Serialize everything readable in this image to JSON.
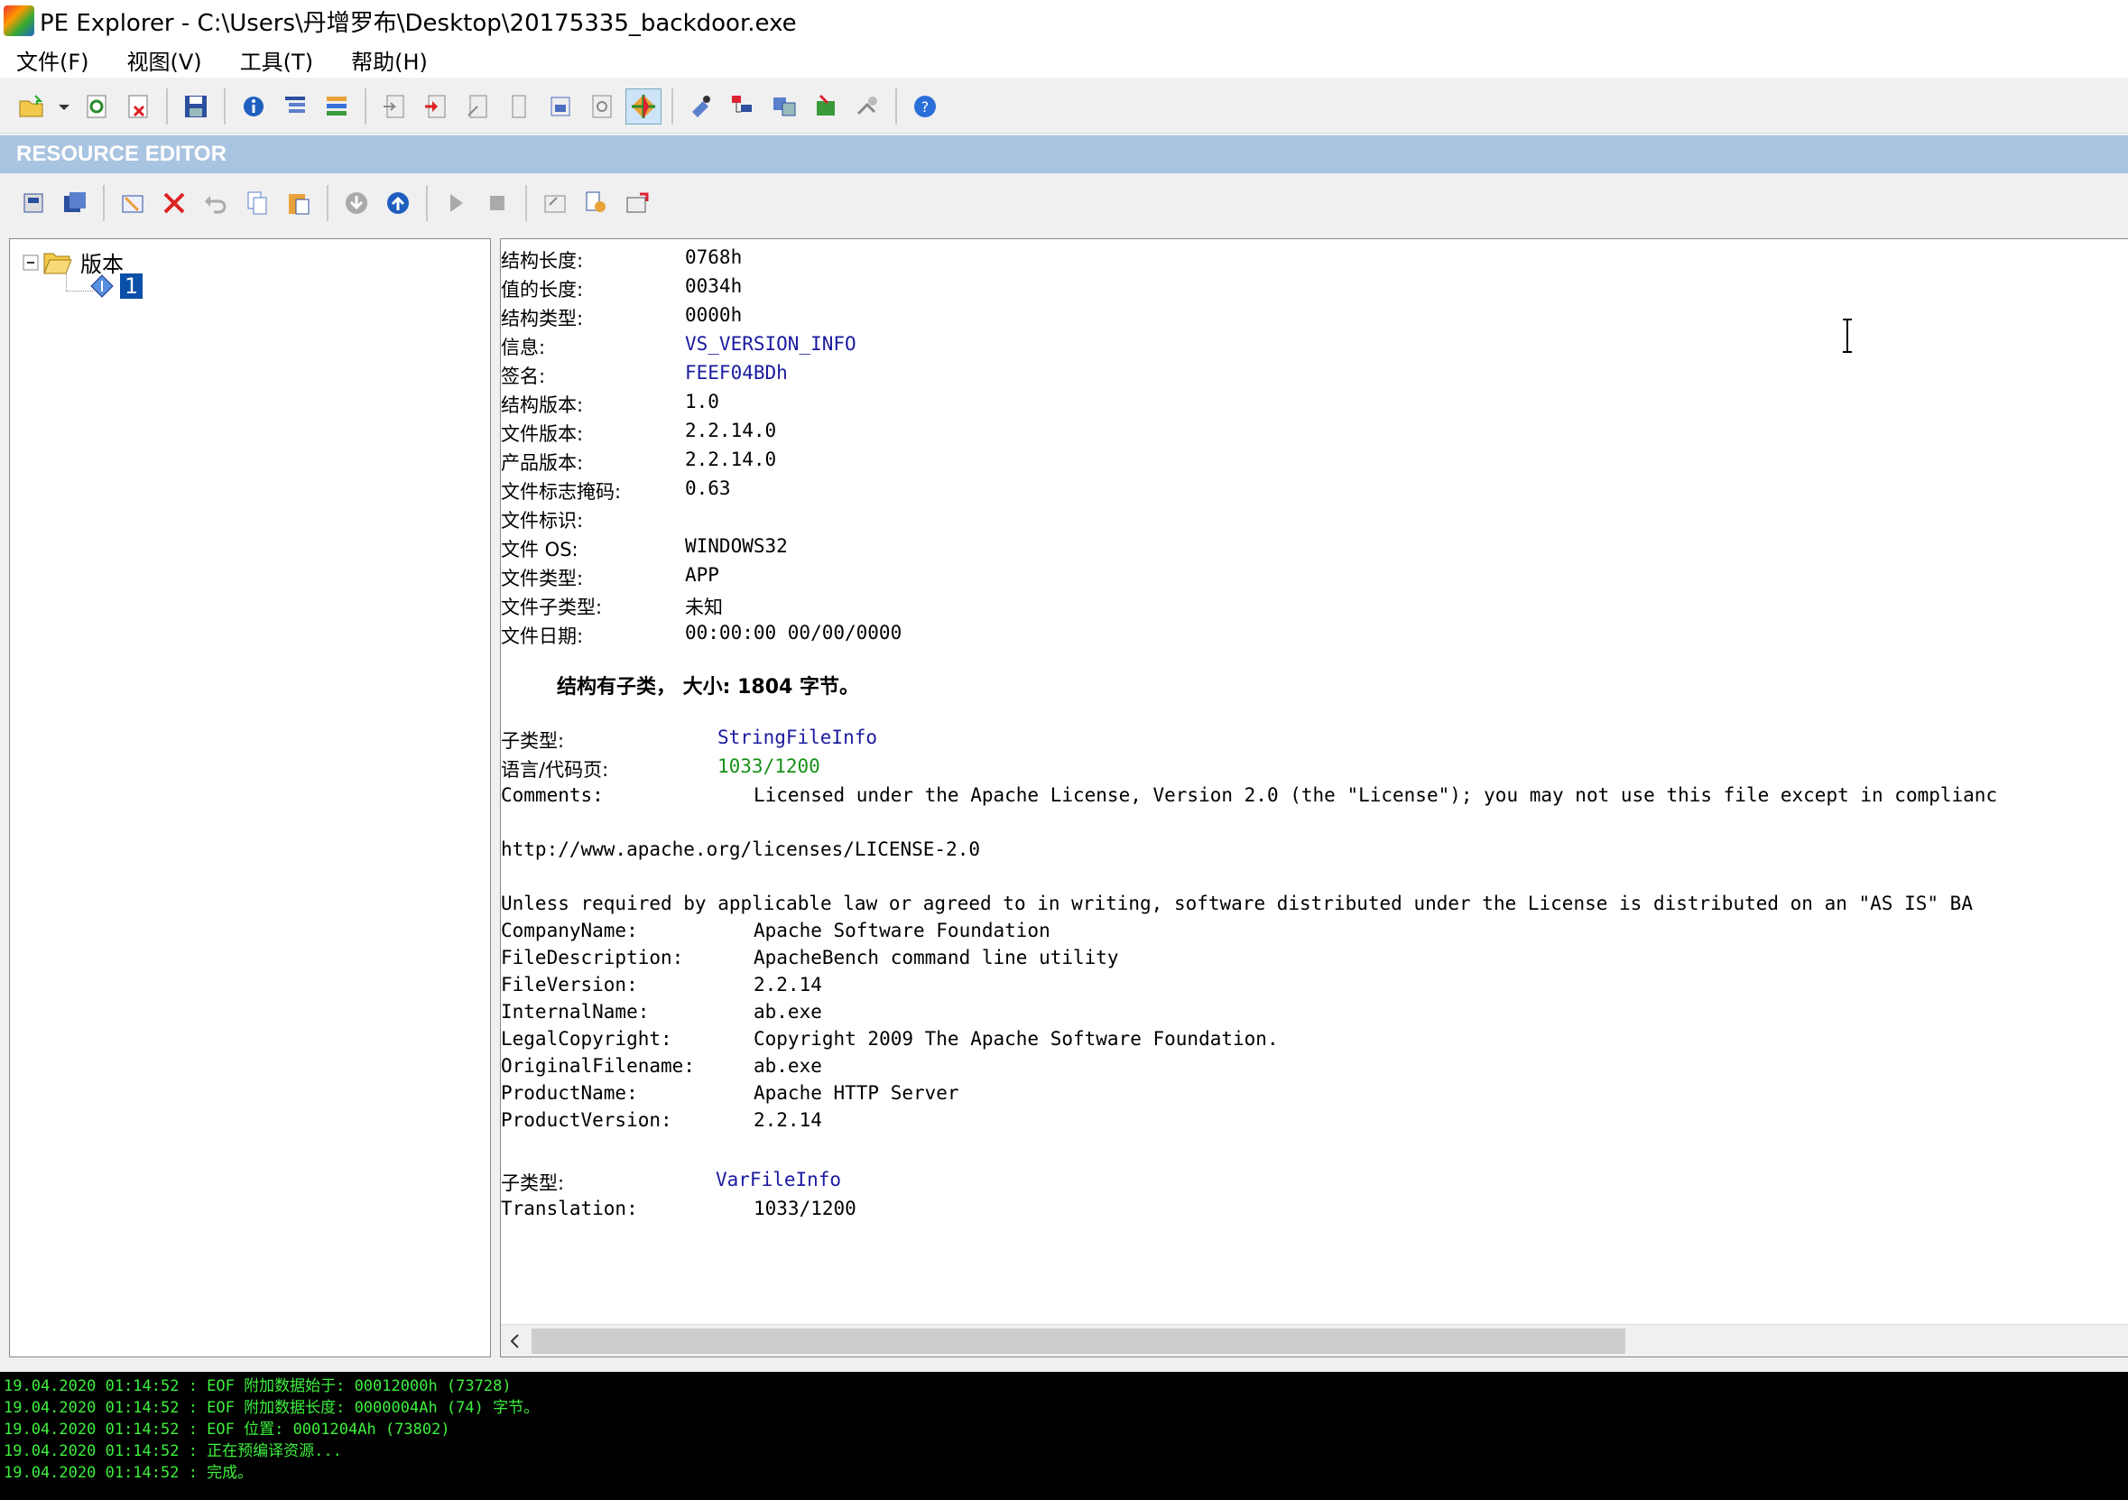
{
  "window": {
    "title": "PE Explorer - C:\\Users\\丹增罗布\\Desktop\\20175335_backdoor.exe"
  },
  "menu": [
    "文件(F)",
    "视图(V)",
    "工具(T)",
    "帮助(H)"
  ],
  "editor": {
    "header": "RESOURCE EDITOR"
  },
  "tree": {
    "root": "版本",
    "child": "1"
  },
  "fields": [
    {
      "label": "结构长度:",
      "value": "0768h",
      "color": "black"
    },
    {
      "label": "值的长度:",
      "value": "0034h",
      "color": "black"
    },
    {
      "label": "结构类型:",
      "value": "0000h",
      "color": "black"
    },
    {
      "label": "信息:",
      "value": "VS_VERSION_INFO",
      "color": "blue"
    },
    {
      "label": "签名:",
      "value": "FEEF04BDh",
      "color": "blue"
    },
    {
      "label": "结构版本:",
      "value": "1.0",
      "color": "black"
    },
    {
      "label": "文件版本:",
      "value": "2.2.14.0",
      "color": "black"
    },
    {
      "label": "产品版本:",
      "value": "2.2.14.0",
      "color": "black"
    },
    {
      "label": "文件标志掩码:",
      "value": "0.63",
      "color": "black"
    },
    {
      "label": "文件标识:",
      "value": "",
      "color": "black"
    },
    {
      "label": "文件 OS:",
      "value": "WINDOWS32",
      "color": "black"
    },
    {
      "label": "文件类型:",
      "value": "APP",
      "color": "black"
    },
    {
      "label": "文件子类型:",
      "value": "未知",
      "color": "black"
    },
    {
      "label": "文件日期:",
      "value": "00:00:00  00/00/0000",
      "color": "black"
    }
  ],
  "summary": "结构有子类， 大小: 1804 字节。",
  "string_file": {
    "subtype_label": "子类型:",
    "subtype_value": "StringFileInfo",
    "lang_label": "语言/代码页:",
    "lang_value": "1033/1200",
    "comments_label": "Comments:",
    "comments_value": "Licensed under the Apache License, Version 2.0 (the \"License\"); you may not use this file except in complianc",
    "url": "http://www.apache.org/licenses/LICENSE-2.0",
    "unless": "Unless required by applicable law or agreed to in writing, software distributed under the License is distributed on an \"AS IS\" BA",
    "entries": [
      {
        "key": "CompanyName:",
        "value": "Apache Software Foundation"
      },
      {
        "key": "FileDescription:",
        "value": "ApacheBench command line utility"
      },
      {
        "key": "FileVersion:",
        "value": "2.2.14"
      },
      {
        "key": "InternalName:",
        "value": "ab.exe"
      },
      {
        "key": "LegalCopyright:",
        "value": "Copyright 2009 The Apache Software Foundation."
      },
      {
        "key": "OriginalFilename:",
        "value": "ab.exe"
      },
      {
        "key": "ProductName:",
        "value": "Apache HTTP Server"
      },
      {
        "key": "ProductVersion:",
        "value": "2.2.14"
      }
    ]
  },
  "var_file": {
    "subtype_label": "子类型:",
    "subtype_value": "VarFileInfo",
    "translation_label": "Translation:",
    "translation_value": "1033/1200"
  },
  "log": [
    "19.04.2020 01:14:52 : EOF 附加数据始于: 00012000h  (73728)",
    "19.04.2020 01:14:52 : EOF 附加数据长度: 0000004Ah  (74) 字节。",
    "19.04.2020 01:14:52 : EOF 位置: 0001204Ah  (73802)",
    "19.04.2020 01:14:52 : 正在预编译资源...",
    "19.04.2020 01:14:52 : 完成。"
  ],
  "colors": {
    "header_bg": "#a9c4e0",
    "blue_text": "#1a1aa0",
    "green_text": "#189018",
    "log_text": "#3cf03c"
  }
}
